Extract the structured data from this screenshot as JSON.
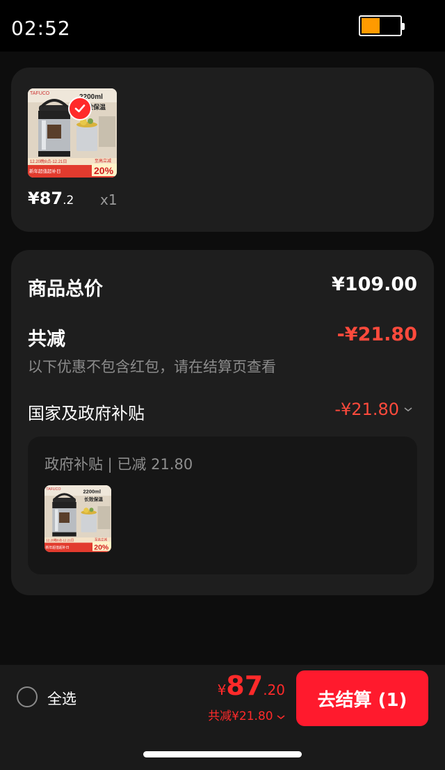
{
  "status_bar": {
    "time": "02:52",
    "battery_color": "#ff9a00"
  },
  "cart_item": {
    "image_icon": "thermos-product-image",
    "price_main": "¥87",
    "price_decimal": ".2",
    "quantity": "x1",
    "selected": true,
    "image_text": {
      "brand": "TAFUCO",
      "capacity": "2200ml",
      "tagline": "长效保温",
      "promo_dates": "12.20晚8点-12.21日",
      "promo_banner": "新年超值超补日",
      "discount": "20%",
      "discount_label": "至高立减"
    }
  },
  "summary": {
    "total_label": "商品总价",
    "total_value": "¥109.00",
    "discount_label": "共减",
    "discount_value": "-¥21.80",
    "note": "以下优惠不包含红包，请在结算页查看",
    "subsidy_label": "国家及政府补贴",
    "subsidy_value": "-¥21.80",
    "subsidy_detail_title": "政府补贴 | 已减 21.80"
  },
  "bottom_bar": {
    "select_all": "全选",
    "total_symbol": "¥",
    "total_int": "87",
    "total_dec": ".20",
    "total_discount": "共减¥21.80",
    "checkout_label": "去结算 (1)"
  },
  "colors": {
    "accent_red": "#ff1a2d",
    "discount_red": "#ff4a3c",
    "card_bg": "#1e1e1e"
  }
}
